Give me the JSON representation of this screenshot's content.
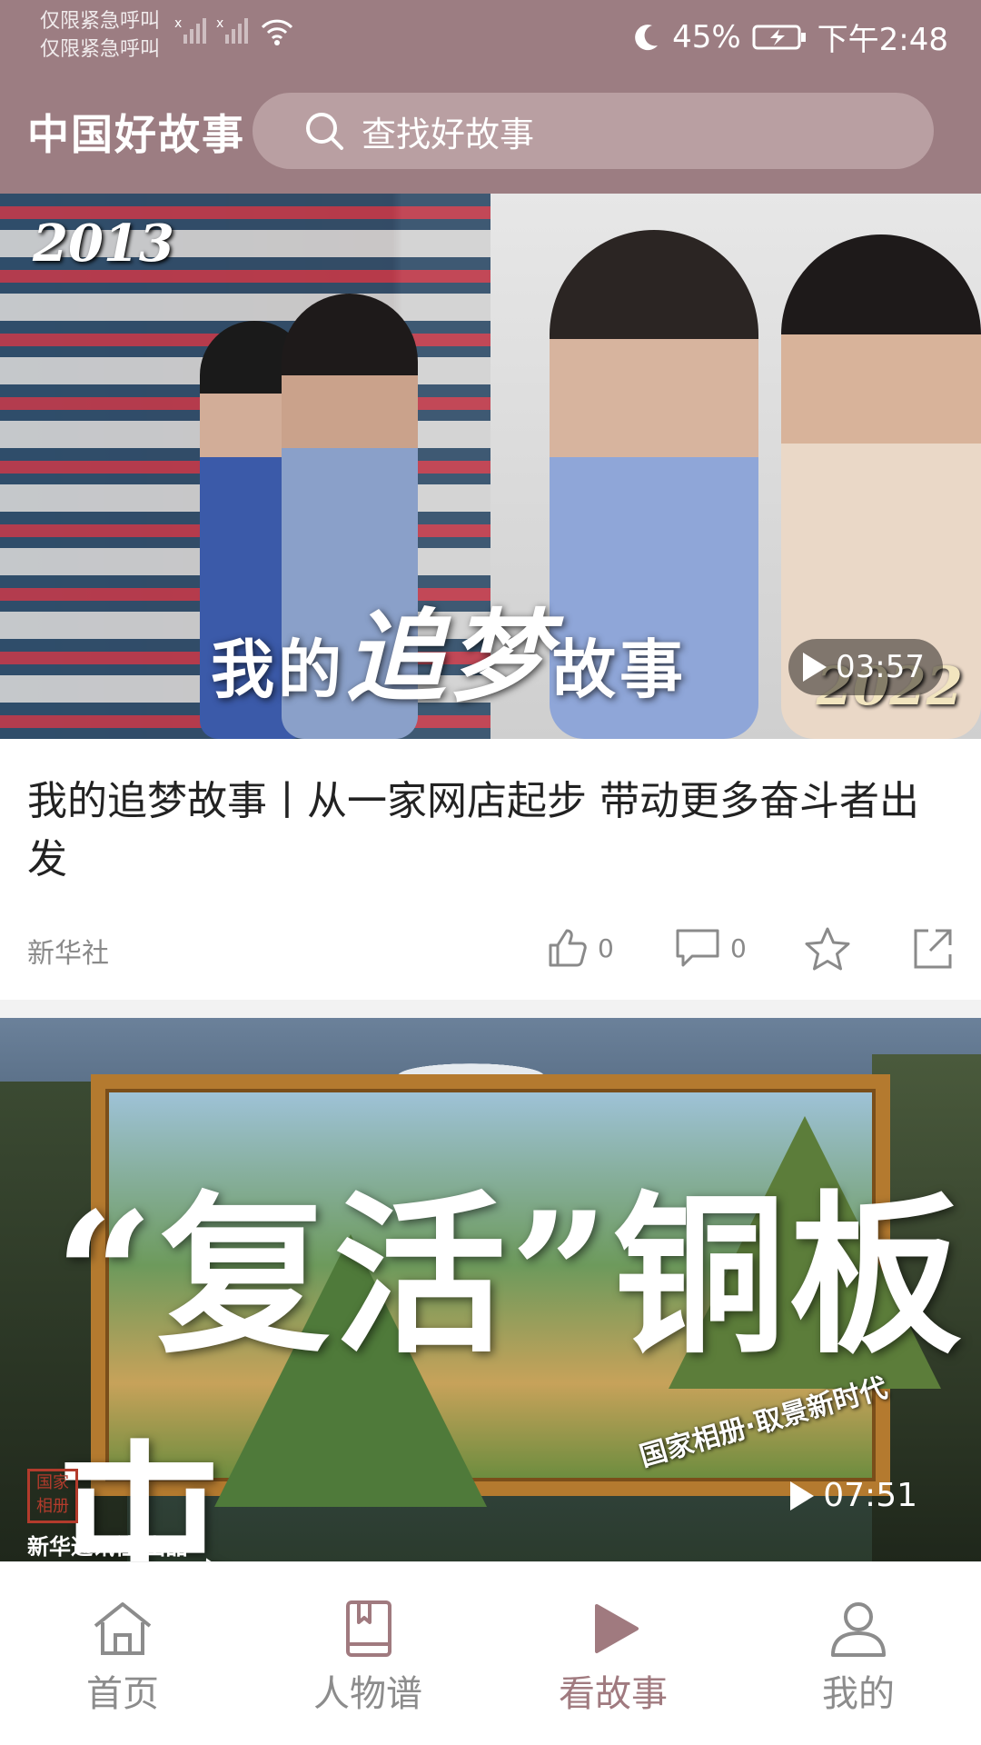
{
  "status_bar": {
    "emergency_line1": "仅限紧急呼叫",
    "emergency_line2": "仅限紧急呼叫",
    "battery": "45%",
    "time": "下午2:48"
  },
  "header": {
    "app_title": "中国好故事",
    "search_placeholder": "查找好故事"
  },
  "card1": {
    "year_left": "2013",
    "year_right": "2022",
    "overlay_prefix": "我的",
    "overlay_big": "追梦",
    "overlay_suffix": "故事",
    "duration": "03:57",
    "title": "我的追梦故事丨从一家网店起步 带动更多奋斗者出发",
    "source": "新华社",
    "likes": "0",
    "comments": "0"
  },
  "card2": {
    "image_title": "“复活”铜板屯",
    "series_text": "国家相册·取景新时代",
    "seal_text": "国家相册",
    "publisher": "新华通讯社 出品",
    "duration": "07:51"
  },
  "bottom_nav": {
    "items": [
      {
        "label": "首页"
      },
      {
        "label": "人物谱"
      },
      {
        "label": "看故事"
      },
      {
        "label": "我的"
      }
    ]
  },
  "colors": {
    "header_bg": "#9c7d82",
    "accent": "#a07a7f"
  }
}
